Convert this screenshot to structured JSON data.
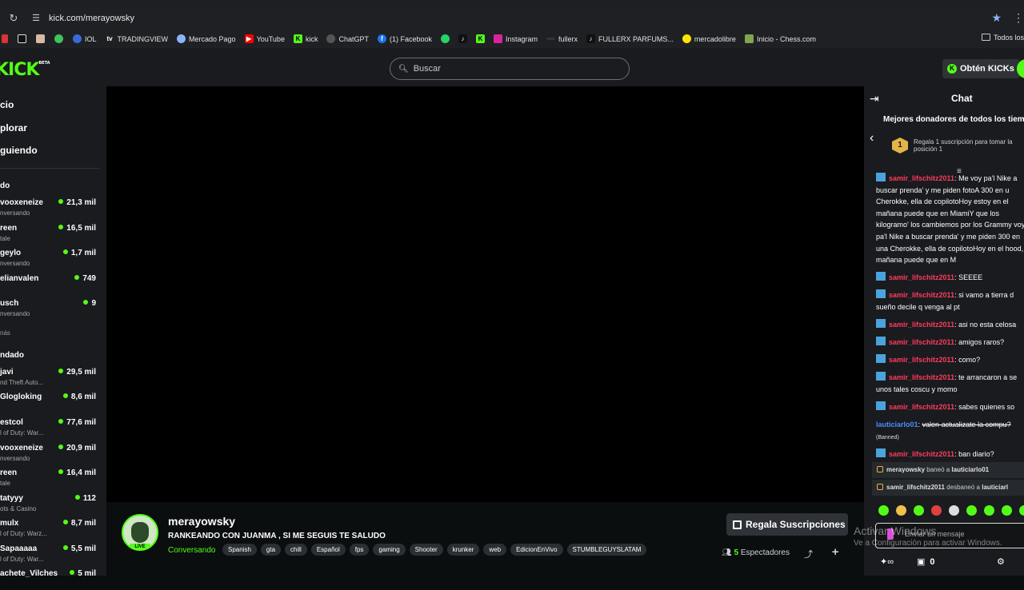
{
  "browser": {
    "url": "kick.com/merayowsky",
    "bookmarks": [
      "IOL",
      "TRADINGVIEW",
      "Mercado Pago",
      "YouTube",
      "kick",
      "ChatGPT",
      "(1) Facebook",
      "Instagram",
      "fullerx",
      "FULLERX PARFUMS...",
      "mercadolibre",
      "Inicio - Chess.com"
    ],
    "all_bookmarks": "Todos los"
  },
  "header": {
    "logo": "KICK",
    "logo_beta": "BETA",
    "search_placeholder": "Buscar",
    "get_kicks": "Obtén KICKs"
  },
  "sidebar": {
    "nav": [
      "cio",
      "plorar",
      "guiendo"
    ],
    "followed_heading": "do",
    "followed": [
      {
        "name": "vooxeneize",
        "sub": "nversando",
        "viewers": "21,3 mil"
      },
      {
        "name": "reen",
        "sub": "tale",
        "viewers": "16,5 mil"
      },
      {
        "name": "geylo",
        "sub": "nversando",
        "viewers": "1,7 mil"
      },
      {
        "name": "elianvalen",
        "sub": "",
        "viewers": "749"
      },
      {
        "name": "usch",
        "sub": "nversando",
        "viewers": "9"
      }
    ],
    "more": "nás",
    "recommended_heading": "ndado",
    "recommended": [
      {
        "name": "javi",
        "sub": "nd Theft Auto...",
        "viewers": "29,5 mil"
      },
      {
        "name": "Glogloking",
        "sub": "",
        "viewers": "8,6 mil"
      },
      {
        "name": "estcol",
        "sub": "l of Duty: War...",
        "viewers": "77,6 mil"
      },
      {
        "name": "vooxeneize",
        "sub": "nversando",
        "viewers": "20,9 mil"
      },
      {
        "name": "reen",
        "sub": "tale",
        "viewers": "16,4 mil"
      },
      {
        "name": "tatyyy",
        "sub": "ots & Casino",
        "viewers": "112"
      },
      {
        "name": "mulx",
        "sub": "l of Duty: Warz...",
        "viewers": "8,7 mil"
      },
      {
        "name": "Sapaaaaa",
        "sub": "l of Duty: War...",
        "viewers": "5,5 mil"
      },
      {
        "name": "achete_Vilches",
        "sub": "",
        "viewers": "5 mil"
      }
    ]
  },
  "stream": {
    "channel": "merayowsky",
    "live": "LIVE",
    "title": "RANKEANDO CON JUANMA , SI ME SEGUIS TE SALUDO",
    "category": "Conversando",
    "tags": [
      "Spanish",
      "gta",
      "chill",
      "Español",
      "fps",
      "gaming",
      "Shooter",
      "krunker",
      "web",
      "EdicionEnVivo",
      "STUMBLEGUYSLATAM"
    ],
    "gift_button": "Regala Suscripciones",
    "viewers_count": "5",
    "viewers_label": "Espectadores"
  },
  "chat": {
    "title": "Chat",
    "donors_heading": "Mejores donadores de todos los tiem",
    "donors_rank": "1",
    "donors_text": "Regala 1 suscripción para tomar la posición 1",
    "messages": [
      {
        "user": "samir_lifschitz2011",
        "text": "Me voy pa'l Nike a buscar prenda' y me piden fotoA 300 en u Cherokke, ella de copilotoHoy estoy en el mañana puede que en MiamiY que los kilogramo' los cambiemos por los Grammy voy pa'l Nike a buscar prenda' y me piden 300 en una Cherokke, ella de copilotoHoy en el hood, mañana puede que en M"
      },
      {
        "user": "samir_lifschitz2011",
        "text": "SEEEE"
      },
      {
        "user": "samir_lifschitz2011",
        "text": "si vamo a tierra d sueño decile q venga al pt"
      },
      {
        "user": "samir_lifschitz2011",
        "text": "asi no esta celosa"
      },
      {
        "user": "samir_lifschitz2011",
        "text": "amigos raros?"
      },
      {
        "user": "samir_lifschitz2011",
        "text": "como?"
      },
      {
        "user": "samir_lifschitz2011",
        "text": "te arrancaron a se unos tales coscu y momo"
      },
      {
        "user": "samir_lifschitz2011",
        "text": "sabes quienes so"
      },
      {
        "user": "lauticiarlo01",
        "text": "valen actualizate la compu?",
        "banned_tag": "(Banned)"
      },
      {
        "user": "samir_lifschitz2011",
        "text": "ban diario?"
      }
    ],
    "modlog": [
      {
        "actor": "merayowsky",
        "action": "baneó a",
        "target": "lauticiarlo01"
      },
      {
        "actor": "samir_lifschitz2011",
        "action": "desbaneó a",
        "target": "lauticiarl"
      }
    ],
    "input_placeholder": "Enviar un mensaje",
    "footer_count": "0",
    "watermark_1": "Activar Windows",
    "watermark_2": "Ve a Configuración para activar Windows."
  }
}
